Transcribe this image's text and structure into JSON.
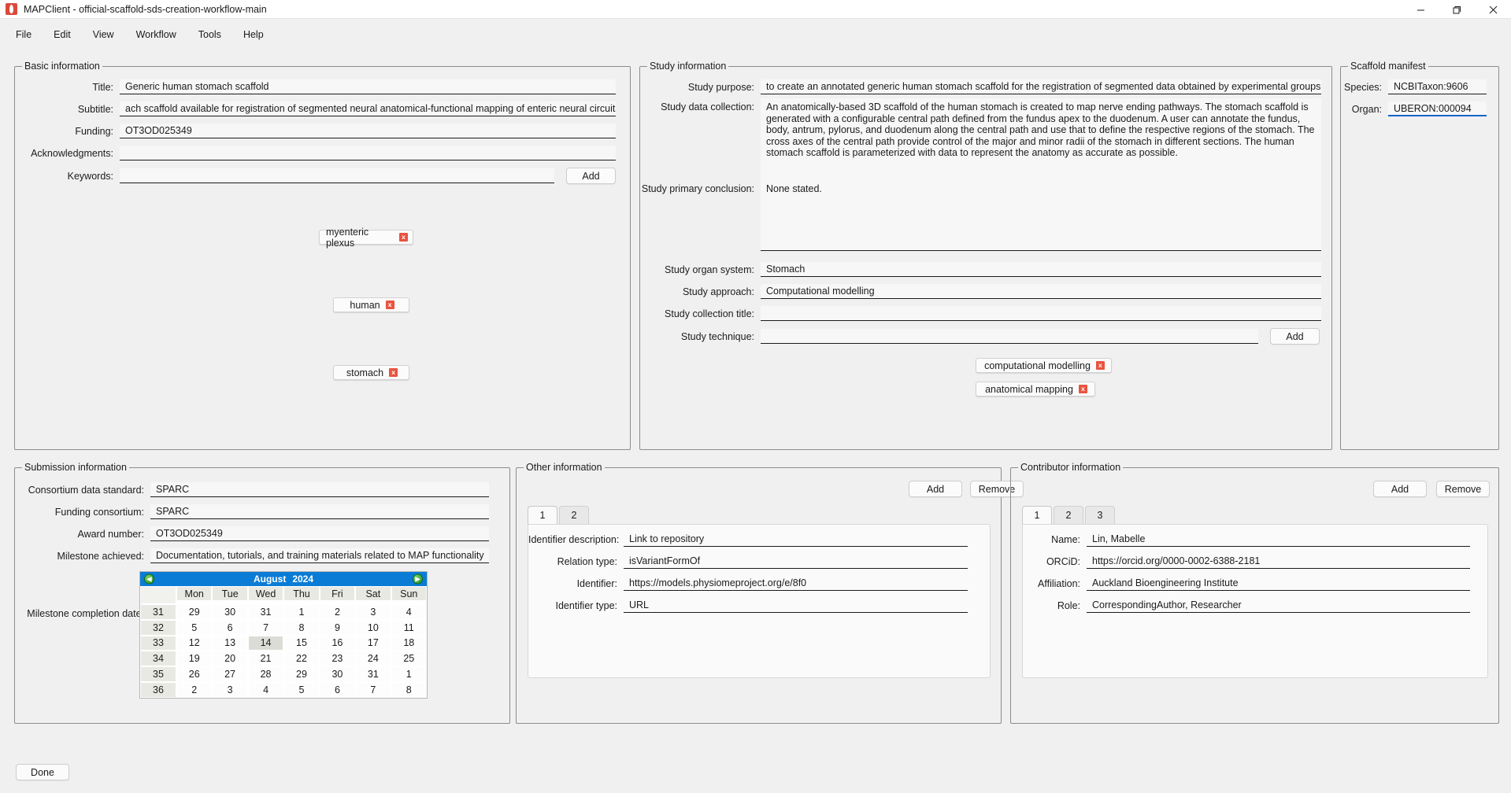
{
  "window": {
    "title": "MAPClient - official-scaffold-sds-creation-workflow-main",
    "minimize": "—",
    "maximize": "❐",
    "close": "✕"
  },
  "menubar": [
    "File",
    "Edit",
    "View",
    "Workflow",
    "Tools",
    "Help"
  ],
  "basic_information": {
    "legend": "Basic information",
    "title_label": "Title:",
    "title_value": "Generic human stomach scaffold",
    "subtitle_label": "Subtitle:",
    "subtitle_value": "ach scaffold available for registration of segmented neural anatomical-functional mapping of enteric neural circuits.",
    "funding_label": "Funding:",
    "funding_value": "OT3OD025349",
    "acknowledgments_label": "Acknowledgments:",
    "acknowledgments_value": "",
    "keywords_label": "Keywords:",
    "keywords_value": "",
    "add_label": "Add",
    "keyword_chips": [
      {
        "label": "myenteric plexus",
        "remove": "x"
      },
      {
        "label": "human",
        "remove": "x"
      },
      {
        "label": "stomach",
        "remove": "x"
      }
    ]
  },
  "study_information": {
    "legend": "Study information",
    "purpose_label": "Study purpose:",
    "purpose_value": "to create an annotated generic human stomach scaffold for the registration of segmented data obtained by experimental groups.",
    "data_collection_label": "Study data collection:",
    "data_collection_value": "An anatomically-based 3D scaffold of the human stomach is created to map nerve ending pathways. The stomach scaffold is generated with a configurable central path defined from the fundus apex to the duodenum. A user can annotate the fundus, body, antrum, pylorus, and duodenum along the central path and use that to define the respective regions of the stomach. The cross axes of the central path provide control of the major and minor radii of the stomach in different sections. The human stomach scaffold is parameterized with data to represent the anatomy as accurate as possible.",
    "primary_conclusion_label": "Study primary conclusion:",
    "primary_conclusion_value": "None stated.",
    "organ_system_label": "Study organ system:",
    "organ_system_value": "Stomach",
    "approach_label": "Study approach:",
    "approach_value": "Computational modelling",
    "collection_title_label": "Study collection title:",
    "collection_title_value": "",
    "technique_label": "Study technique:",
    "technique_value": "",
    "add_label": "Add",
    "technique_chips": [
      {
        "label": "computational modelling",
        "remove": "x"
      },
      {
        "label": "anatomical mapping",
        "remove": "x"
      }
    ]
  },
  "scaffold_manifest": {
    "legend": "Scaffold manifest",
    "species_label": "Species:",
    "species_value": "NCBITaxon:9606",
    "organ_label": "Organ:",
    "organ_value": "UBERON:000094",
    "focus_color": "#0a64c8"
  },
  "submission_information": {
    "legend": "Submission information",
    "consortium_standard_label": "Consortium data standard:",
    "consortium_standard_value": "SPARC",
    "funding_consortium_label": "Funding consortium:",
    "funding_consortium_value": "SPARC",
    "award_number_label": "Award number:",
    "award_number_value": "OT3OD025349",
    "milestone_achieved_label": "Milestone achieved:",
    "milestone_achieved_value": "Documentation, tutorials, and training materials related to MAP functionality",
    "milestone_date_label": "Milestone completion date:",
    "calendar": {
      "month": "August",
      "year": "2024",
      "prev_icon": "◀",
      "next_icon": "▶",
      "weekday_headers": [
        "",
        "Mon",
        "Tue",
        "Wed",
        "Thu",
        "Fri",
        "Sat",
        "Sun"
      ],
      "selected_day": "14",
      "weeks": [
        {
          "week": "31",
          "days": [
            "29",
            "30",
            "31",
            "1",
            "2",
            "3",
            "4"
          ],
          "other": [
            true,
            true,
            true,
            false,
            false,
            false,
            false
          ]
        },
        {
          "week": "32",
          "days": [
            "5",
            "6",
            "7",
            "8",
            "9",
            "10",
            "11"
          ],
          "other": [
            false,
            false,
            false,
            false,
            false,
            false,
            false
          ]
        },
        {
          "week": "33",
          "days": [
            "12",
            "13",
            "14",
            "15",
            "16",
            "17",
            "18"
          ],
          "other": [
            false,
            false,
            false,
            false,
            false,
            false,
            false
          ]
        },
        {
          "week": "34",
          "days": [
            "19",
            "20",
            "21",
            "22",
            "23",
            "24",
            "25"
          ],
          "other": [
            false,
            false,
            false,
            false,
            false,
            false,
            false
          ]
        },
        {
          "week": "35",
          "days": [
            "26",
            "27",
            "28",
            "29",
            "30",
            "31",
            "1"
          ],
          "other": [
            false,
            false,
            false,
            false,
            false,
            false,
            true
          ]
        },
        {
          "week": "36",
          "days": [
            "2",
            "3",
            "4",
            "5",
            "6",
            "7",
            "8"
          ],
          "other": [
            true,
            true,
            true,
            true,
            true,
            true,
            true
          ]
        }
      ]
    }
  },
  "other_information": {
    "legend": "Other information",
    "add_label": "Add",
    "remove_label": "Remove",
    "tabs": [
      "1",
      "2"
    ],
    "active_tab": "1",
    "identifier_description_label": "Identifier description:",
    "identifier_description_value": "Link to repository",
    "relation_type_label": "Relation type:",
    "relation_type_value": "isVariantFormOf",
    "identifier_label": "Identifier:",
    "identifier_value": "https://models.physiomeproject.org/e/8f0",
    "identifier_type_label": "Identifier type:",
    "identifier_type_value": "URL"
  },
  "contributor_information": {
    "legend": "Contributor information",
    "add_label": "Add",
    "remove_label": "Remove",
    "tabs": [
      "1",
      "2",
      "3"
    ],
    "active_tab": "1",
    "name_label": "Name:",
    "name_value": "Lin, Mabelle",
    "orcid_label": "ORCiD:",
    "orcid_value": "https://orcid.org/0000-0002-6388-2181",
    "affiliation_label": "Affiliation:",
    "affiliation_value": "Auckland Bioengineering Institute",
    "role_label": "Role:",
    "role_value": "CorrespondingAuthor, Researcher"
  },
  "footer": {
    "done_label": "Done"
  }
}
